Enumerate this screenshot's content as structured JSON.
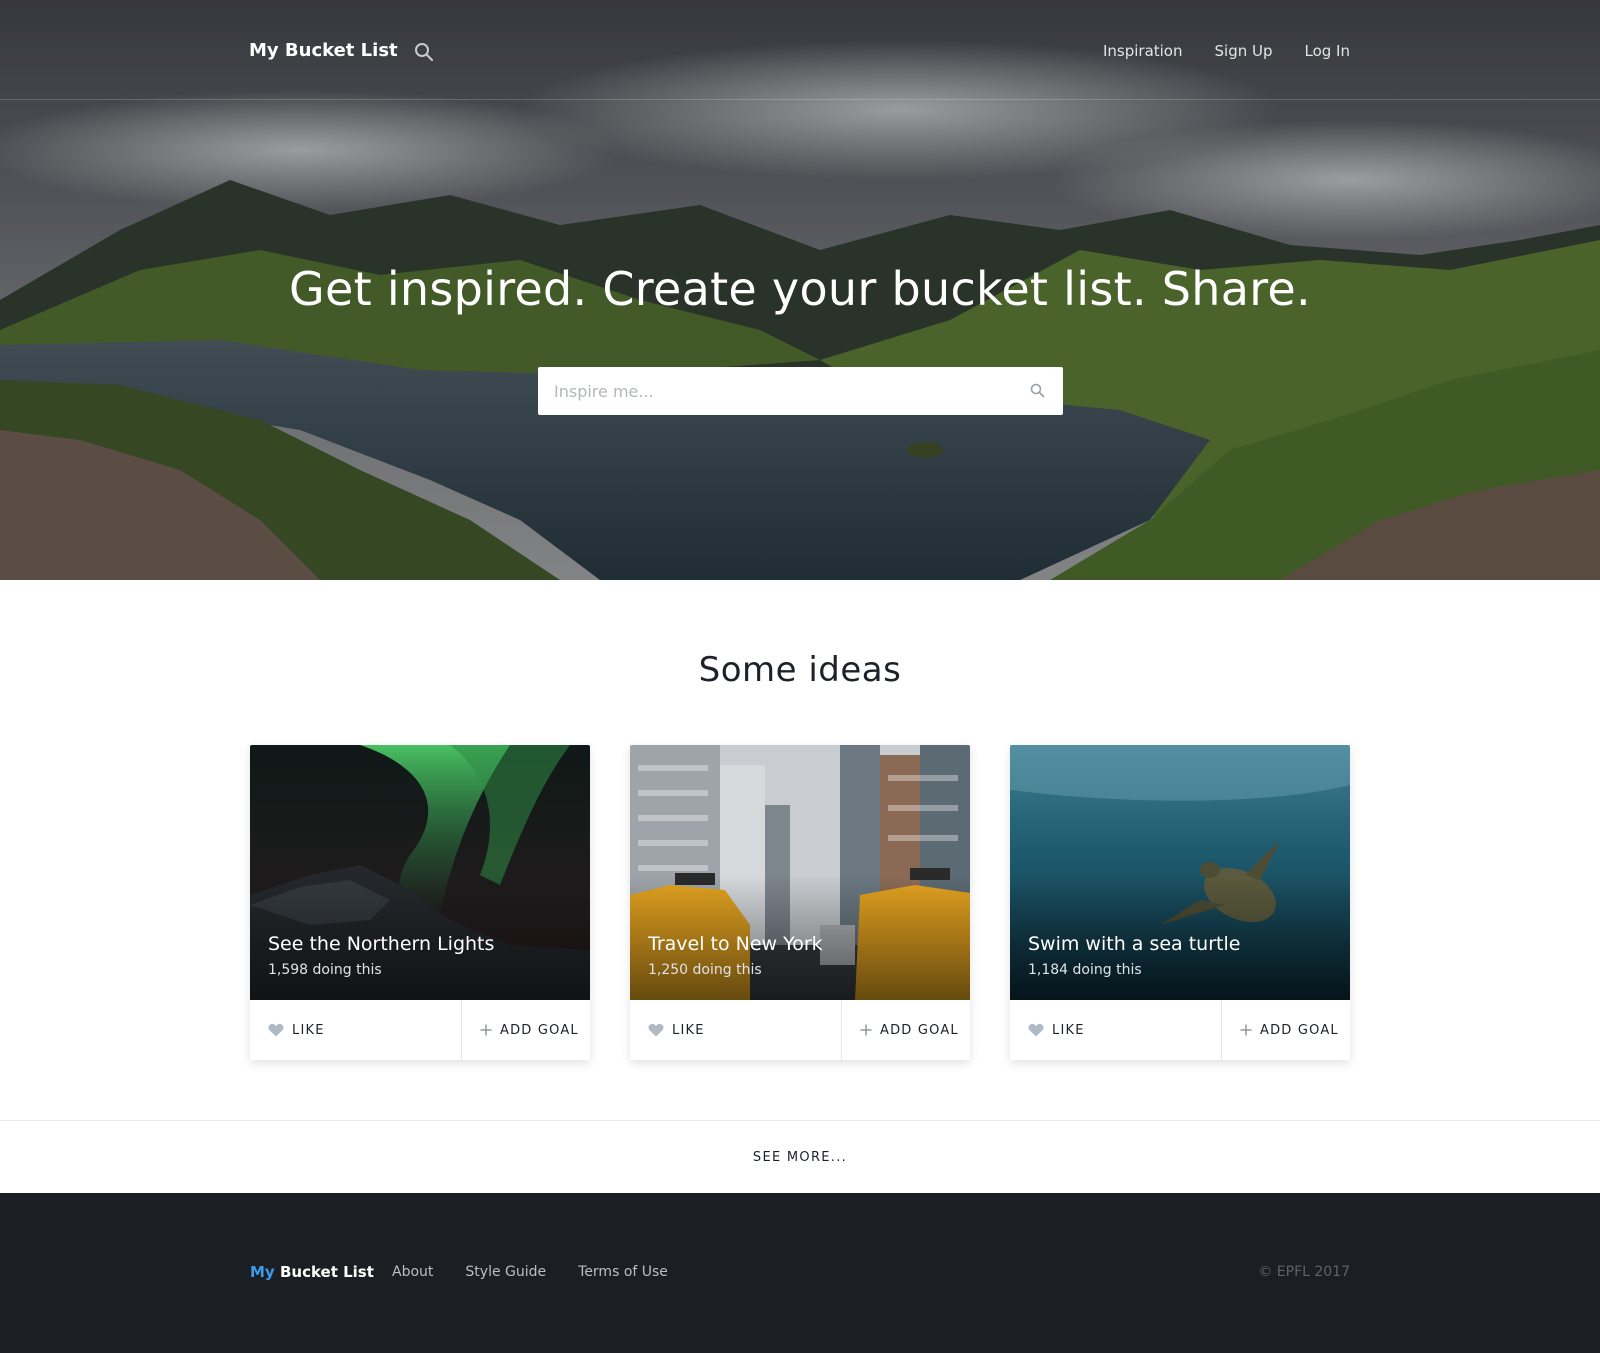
{
  "header": {
    "brand": "My Bucket List",
    "nav": [
      "Inspiration",
      "Sign Up",
      "Log In"
    ]
  },
  "hero": {
    "title": "Get inspired. Create your bucket list. Share.",
    "search_placeholder": "Inspire me..."
  },
  "ideas": {
    "title": "Some ideas",
    "cards": [
      {
        "title": "See the Northern Lights",
        "count": "1,598 doing this",
        "like": "LIKE",
        "add": "ADD GOAL"
      },
      {
        "title": "Travel to New York",
        "count": "1,250 doing this",
        "like": "LIKE",
        "add": "ADD GOAL"
      },
      {
        "title": "Swim with a sea turtle",
        "count": "1,184 doing this",
        "like": "LIKE",
        "add": "ADD GOAL"
      }
    ],
    "see_more": "SEE MORE..."
  },
  "footer": {
    "brand_my": "My",
    "brand_rest": "Bucket List",
    "links": [
      "About",
      "Style Guide",
      "Terms of Use"
    ],
    "copyright": "© EPFL 2017"
  },
  "colors": {
    "accent_blue": "#3b9bea",
    "footer_bg": "#1b1f24",
    "text_dark": "#1d2128"
  },
  "icons": [
    "search-icon",
    "heart-icon",
    "plus-icon"
  ]
}
